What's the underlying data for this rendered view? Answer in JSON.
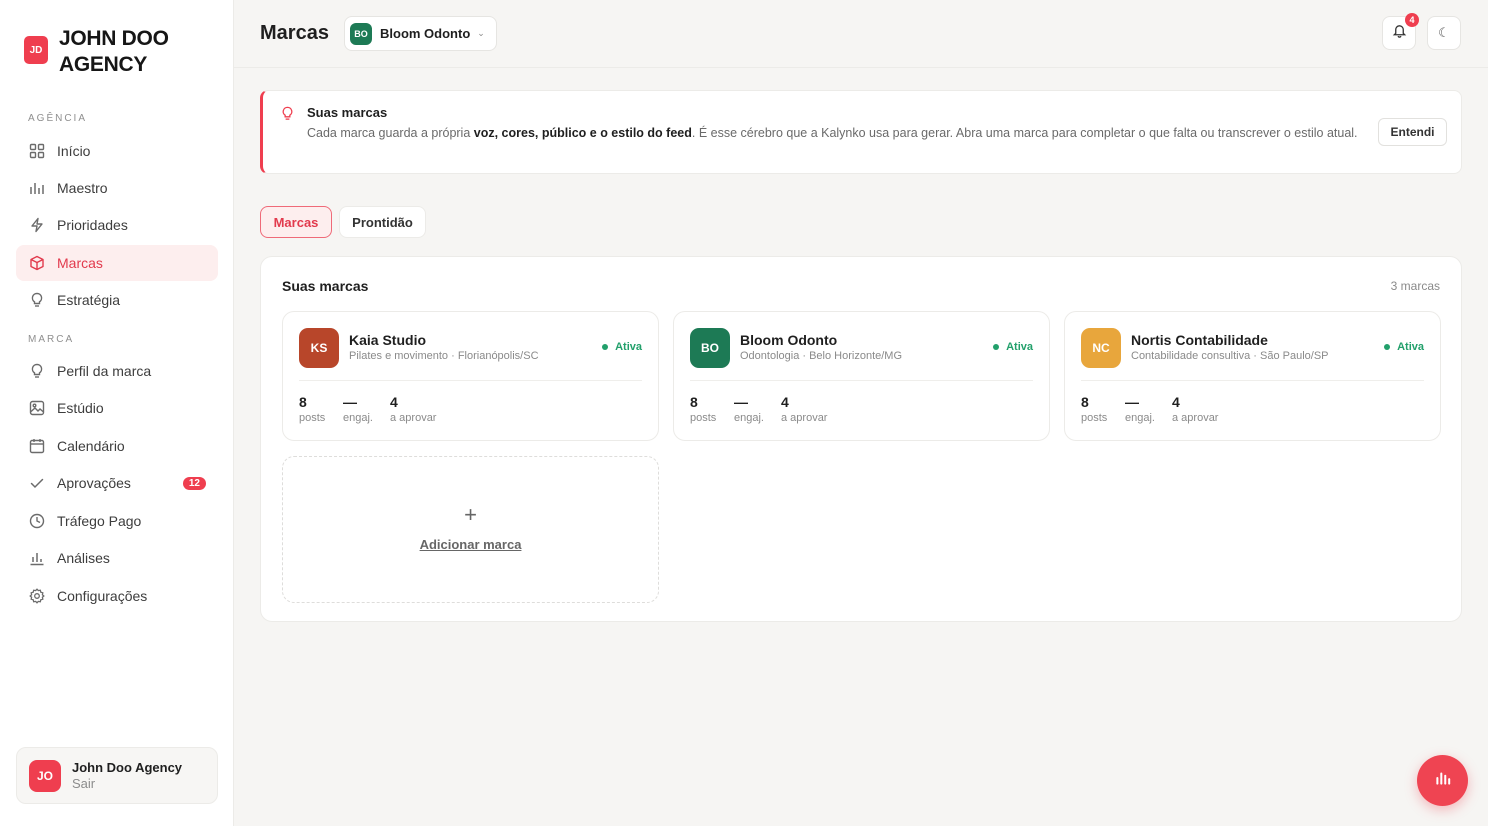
{
  "app": {
    "logo_initials": "JD",
    "name": "JOHN DOO AGENCY"
  },
  "sidebar": {
    "section_agency": "AGÊNCIA",
    "agency_items": [
      {
        "label": "Início",
        "icon": "grid-icon"
      },
      {
        "label": "Maestro",
        "icon": "bars-icon"
      },
      {
        "label": "Prioridades",
        "icon": "lightning-icon"
      },
      {
        "label": "Marcas",
        "icon": "cube-icon",
        "active": true
      }
    ],
    "strategy_item": {
      "label": "Estratégia",
      "icon": "lightbulb-icon"
    },
    "section_brand": "MARCA",
    "brand_items": [
      {
        "label": "Perfil da marca",
        "icon": "lightbulb-icon"
      },
      {
        "label": "Estúdio",
        "icon": "image-icon"
      },
      {
        "label": "Calendário",
        "icon": "calendar-icon"
      },
      {
        "label": "Aprovações",
        "icon": "check-icon",
        "badge": "12"
      },
      {
        "label": "Tráfego Pago",
        "icon": "clock-icon"
      },
      {
        "label": "Análises",
        "icon": "bar-chart-icon"
      },
      {
        "label": "Configurações",
        "icon": "gear-icon"
      }
    ],
    "user": {
      "initials": "JO",
      "name": "John Doo Agency",
      "action": "Sair"
    }
  },
  "header": {
    "title": "Marcas",
    "selected_brand": {
      "initials": "BO",
      "label": "Bloom Odonto"
    },
    "notifications_count": "4",
    "theme_icon": "moon-icon"
  },
  "banner": {
    "title": "Suas marcas",
    "text_before": "Cada marca guarda a própria ",
    "text_bold": "voz, cores, público e o estilo do feed",
    "text_after": ". É esse cérebro que a Kalynko usa para gerar. Abra uma marca para completar o que falta ou transcrever o estilo atual.",
    "button": "Entendi"
  },
  "tabs": [
    {
      "label": "Marcas",
      "active": true
    },
    {
      "label": "Prontidão",
      "active": false
    }
  ],
  "brands_panel": {
    "title": "Suas marcas",
    "count": "3 marcas",
    "cards": [
      {
        "initials": "KS",
        "color": "#b8462a",
        "name": "Kaia Studio",
        "subtitle": "Pilates e movimento · Florianópolis/SC",
        "status": "Ativa",
        "stats": [
          {
            "value": "8",
            "label": "posts"
          },
          {
            "value": "—",
            "label": "engaj."
          },
          {
            "value": "4",
            "label": "a aprovar"
          }
        ]
      },
      {
        "initials": "BO",
        "color": "#1d7a55",
        "name": "Bloom Odonto",
        "subtitle": "Odontologia · Belo Horizonte/MG",
        "status": "Ativa",
        "stats": [
          {
            "value": "8",
            "label": "posts"
          },
          {
            "value": "—",
            "label": "engaj."
          },
          {
            "value": "4",
            "label": "a aprovar"
          }
        ]
      },
      {
        "initials": "NC",
        "color": "#e8a63c",
        "name": "Nortis Contabilidade",
        "subtitle": "Contabilidade consultiva · São Paulo/SP",
        "status": "Ativa",
        "stats": [
          {
            "value": "8",
            "label": "posts"
          },
          {
            "value": "—",
            "label": "engaj."
          },
          {
            "value": "4",
            "label": "a aprovar"
          }
        ]
      }
    ],
    "add": {
      "plus": "+",
      "label": "Adicionar marca"
    }
  },
  "fab": {
    "icon": "bars-icon"
  }
}
